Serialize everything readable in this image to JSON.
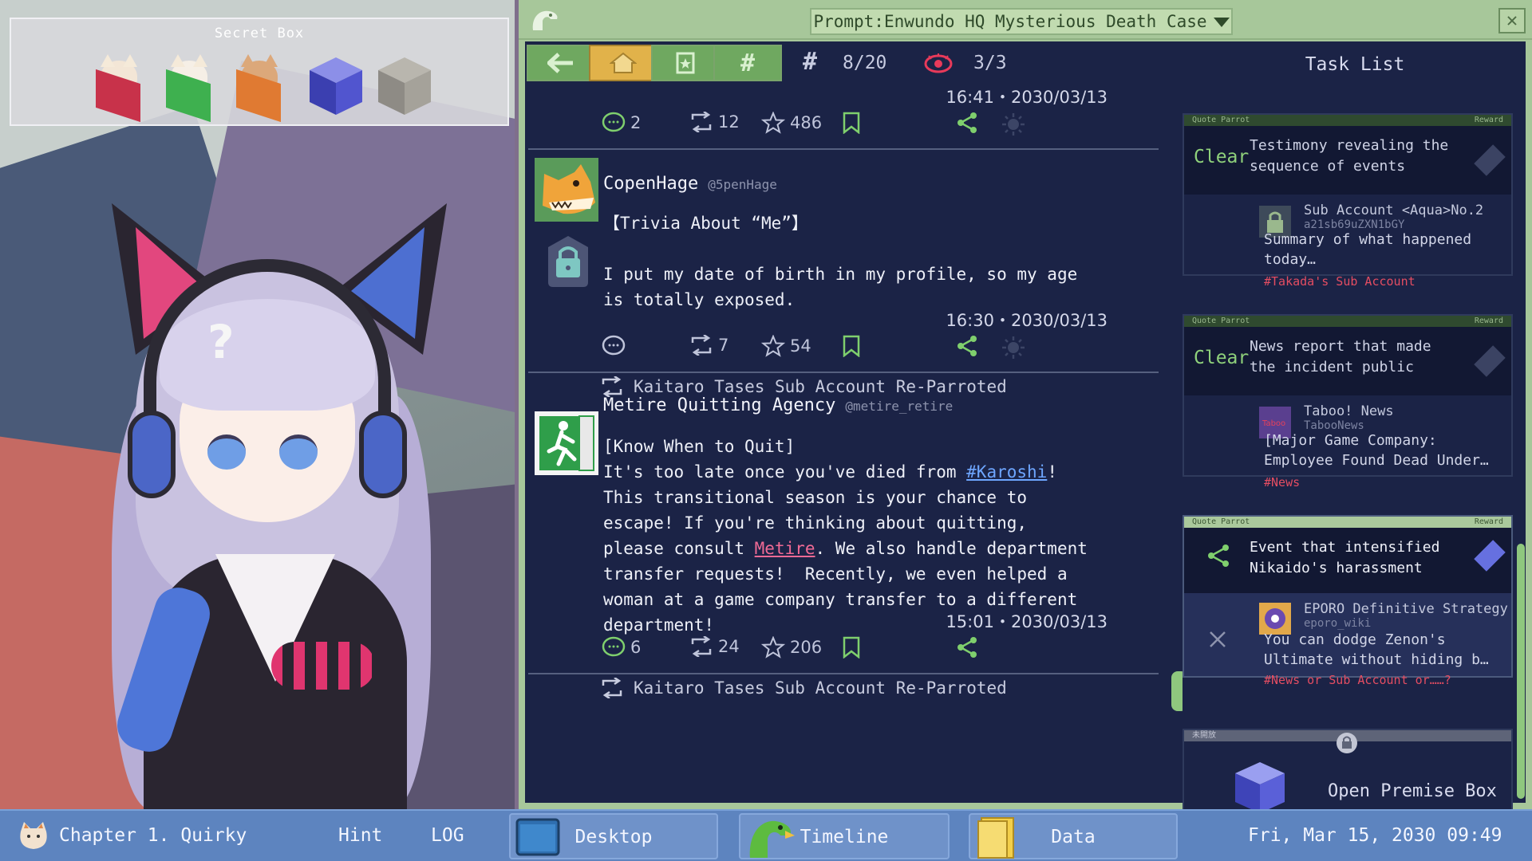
{
  "secret_box": {
    "title": "Secret Box"
  },
  "window": {
    "title": "Prompt:Enwundo HQ Mysterious Death Case"
  },
  "toolbar": {
    "hash_label": "#",
    "hash_count": "8/20",
    "eye_count": "3/3"
  },
  "posts": [
    {
      "timestamp": "16:41・2030/03/13",
      "comments": "2",
      "reposts": "12",
      "likes": "486"
    },
    {
      "name": "CopenHage",
      "handle": "@5penHage",
      "body": "【Trivia About “Me”】\n\nI put my date of birth in my profile, so my age\nis totally exposed.",
      "timestamp": "16:30・2030/03/13",
      "comments": "",
      "reposts": "7",
      "likes": "54"
    },
    {
      "reposter": "Kaitaro Tases Sub Account Re-Parroted",
      "name": "Metire Quitting Agency",
      "handle": "@metire_retire",
      "body_1": "[Know When to Quit]\nIt's too late once you've died from ",
      "hashtag": "#Karoshi",
      "body_2": "!\nThis transitional season is your chance to\nescape! If you're thinking about quitting,\nplease consult ",
      "mention": "Metire",
      "body_3": ". We also handle department\ntransfer requests!  Recently, we even helped a\nwoman at a game company transfer to a different\ndepartment!",
      "timestamp": "15:01・2030/03/13",
      "comments": "6",
      "reposts": "24",
      "likes": "206"
    },
    {
      "reposter": "Kaitaro Tases Sub Account Re-Parroted"
    }
  ],
  "task_list": {
    "title": "Task List",
    "items": [
      {
        "hdr_left": "Quote Parrot",
        "hdr_right": "Reward",
        "status": "Clear",
        "question": "Testimony revealing the\nsequence of events",
        "sub_name": "Sub Account <Aqua>No.2",
        "sub_handle": "a21sb69uZXN1bGY",
        "sub_text": "Summary of what happened\ntoday…",
        "sub_tag": "#Takada's Sub Account"
      },
      {
        "hdr_left": "Quote Parrot",
        "hdr_right": "Reward",
        "status": "Clear",
        "question": "News report that made\nthe incident public",
        "sub_name": "Taboo! News",
        "sub_handle": "TabooNews",
        "sub_text": "[Major Game Company:\nEmployee Found Dead Under…",
        "sub_tag": "#News"
      },
      {
        "hdr_left": "Quote Parrot",
        "hdr_right": "Reward",
        "status": "",
        "question": "Event that intensified\nNikaido's harassment",
        "sub_name": "EPORO Definitive Strategy",
        "sub_handle": "eporo_wiki",
        "sub_text": "You can dodge Zenon's\nUltimate without hiding b…",
        "sub_tag": "#News or Sub Account or……?"
      },
      {
        "hdr_left": "未開放",
        "label": "Open Premise Box"
      }
    ]
  },
  "taskbar": {
    "chapter": "Chapter 1. Quirky",
    "hint": "Hint",
    "log": "LOG",
    "desktop": "Desktop",
    "timeline": "Timeline",
    "data": "Data",
    "clock": "Fri, Mar 15, 2030 09:49"
  },
  "colors": {
    "accent_green": "#8fd17b",
    "panel_bg": "#1b2346",
    "taskbar": "#5d84bf",
    "tag_red": "#e44d62"
  }
}
